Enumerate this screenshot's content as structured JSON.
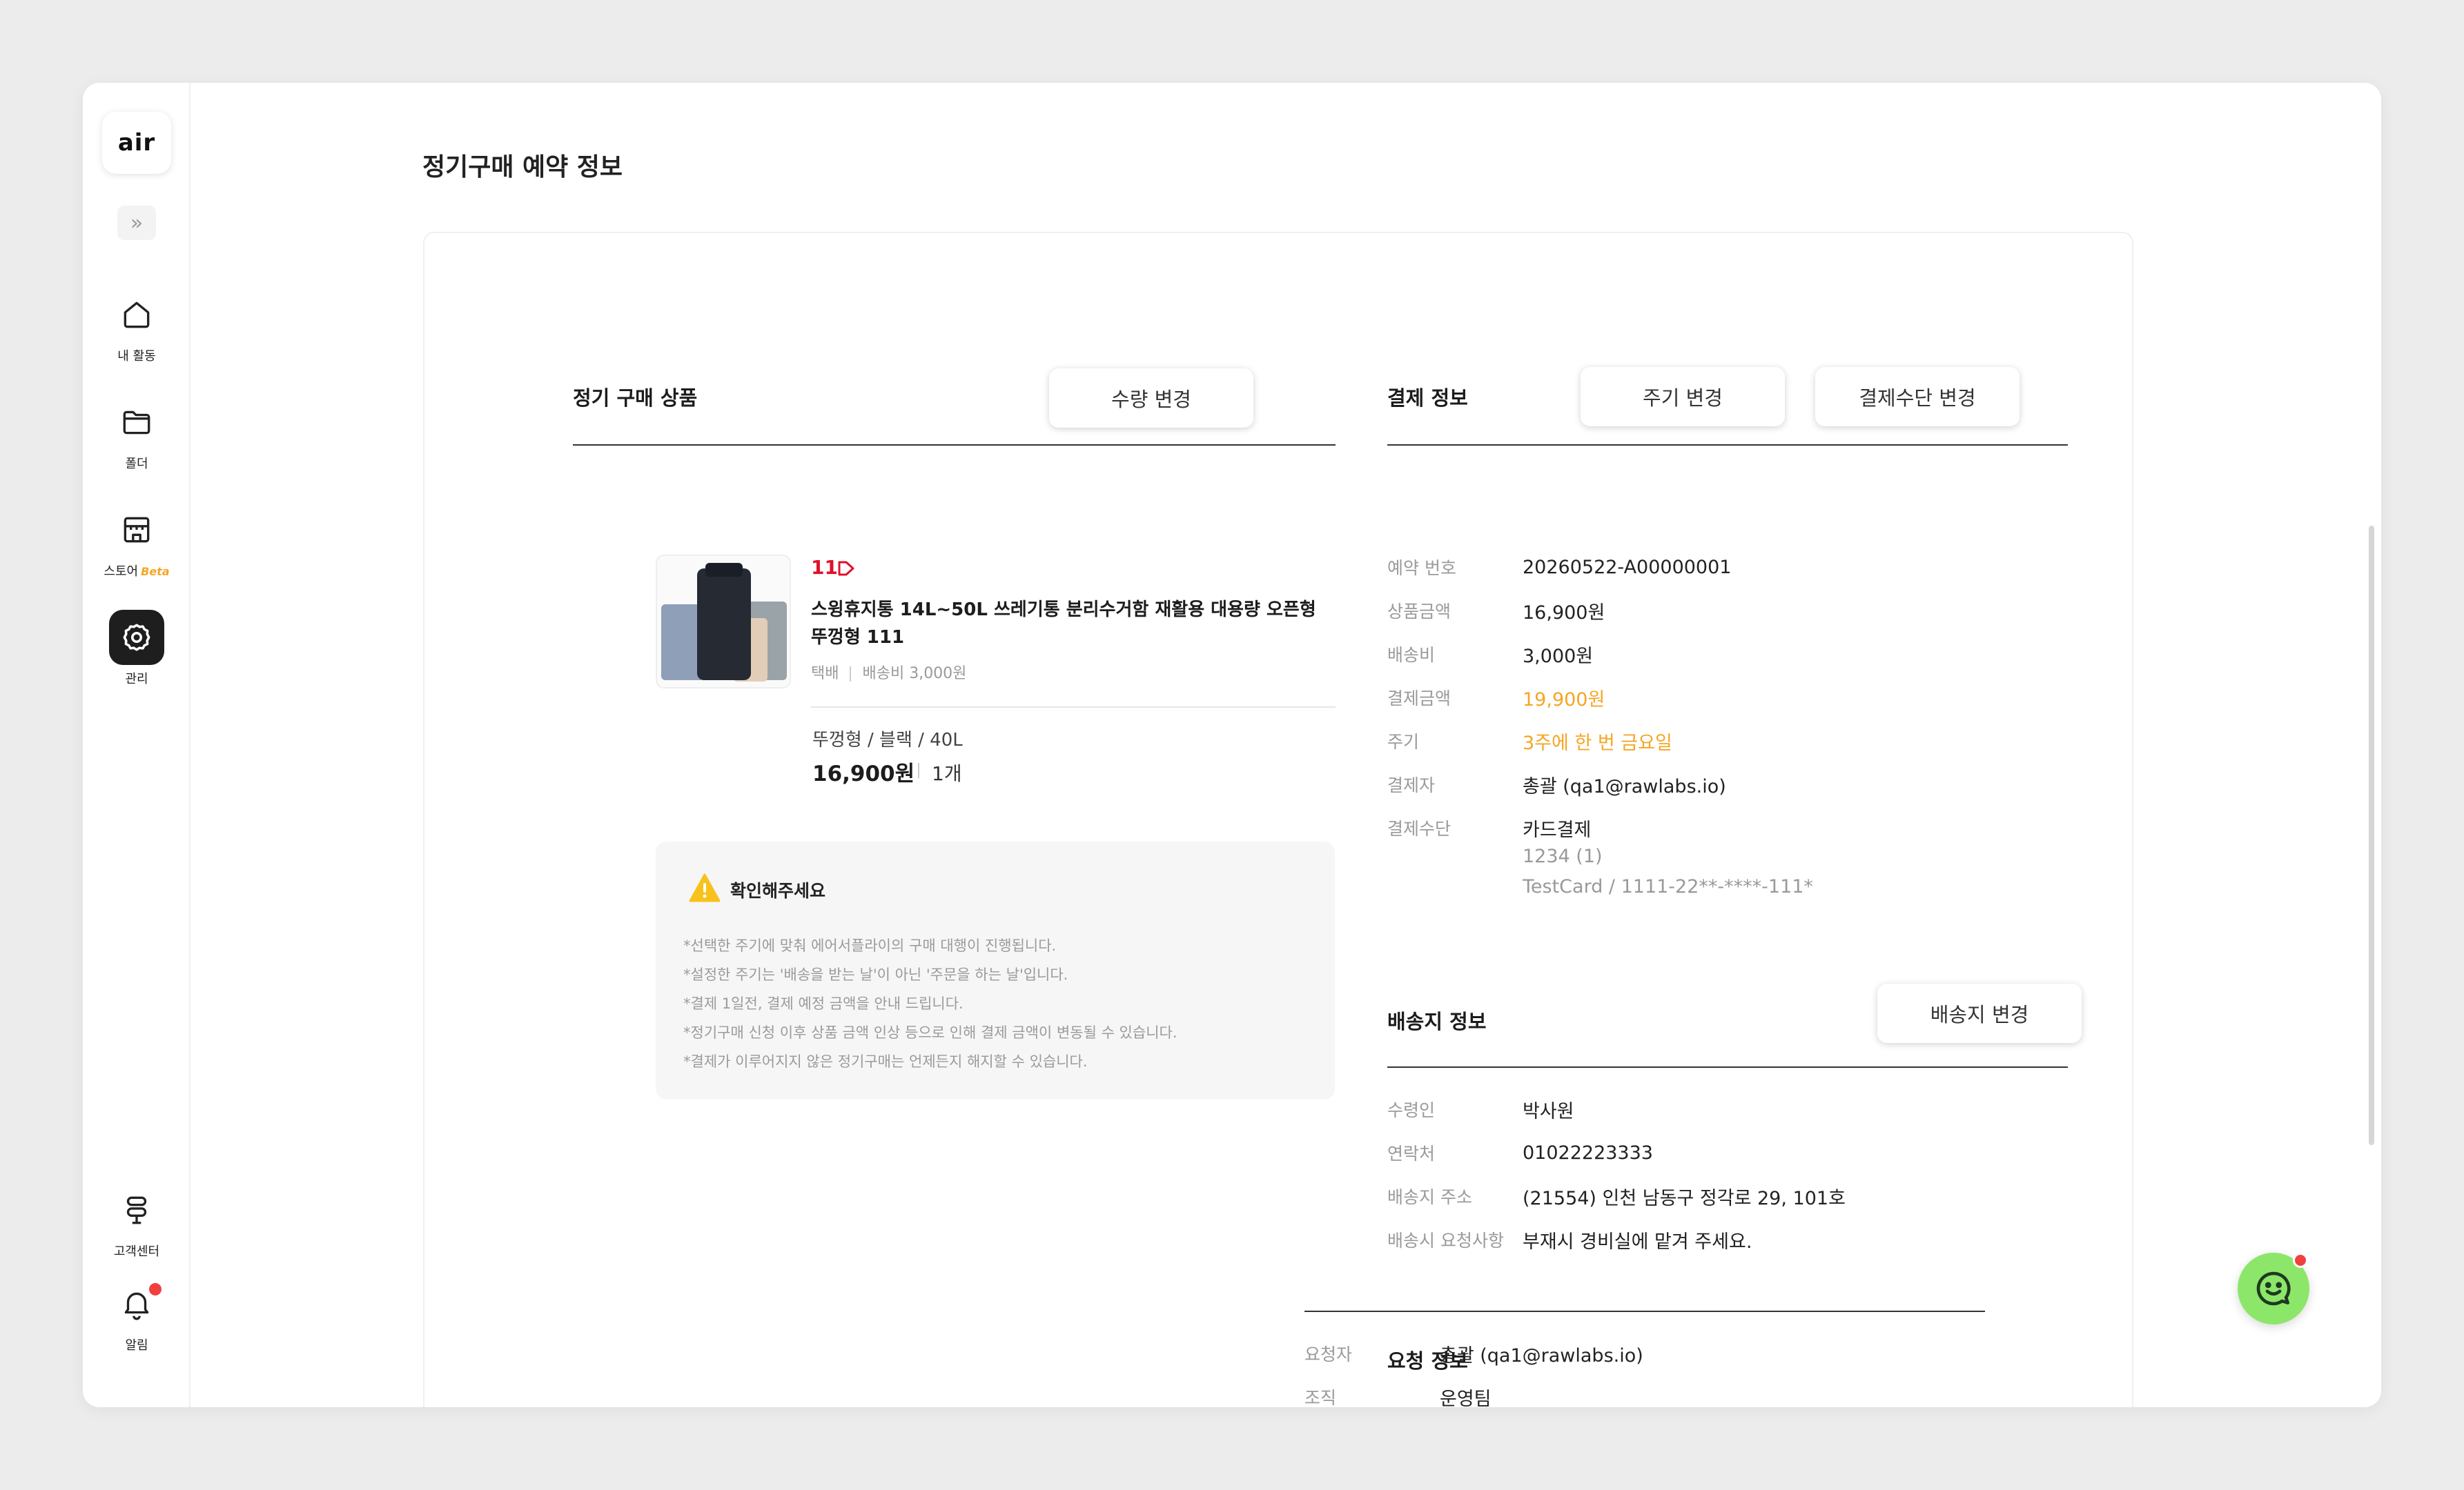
{
  "app": {
    "logo_text": "air",
    "expand_icon": "double-chevron-right-icon",
    "page_title": "정기구매 예약 정보"
  },
  "sidebar": {
    "items": [
      {
        "label": "내 활동",
        "icon": "home-icon"
      },
      {
        "label": "폴더",
        "icon": "folder-icon"
      },
      {
        "label": "스토어",
        "badge": "Beta",
        "icon": "store-icon"
      },
      {
        "label": "관리",
        "icon": "gear-icon",
        "active": true
      }
    ],
    "bottom": [
      {
        "label": "고객센터",
        "icon": "signpost-icon"
      },
      {
        "label": "알림",
        "icon": "bell-icon",
        "has_dot": true
      }
    ]
  },
  "product_section": {
    "title": "정기 구매 상품",
    "button": "수량 변경",
    "mall_logo": "11",
    "product_name": "스윙휴지통 14L~50L 쓰레기통 분리수거함 재활용 대용량 오픈형 뚜껑형 111",
    "delivery": "택배",
    "shipping_fee": "배송비 3,000원",
    "option": "뚜껑형 / 블랙 / 40L",
    "price": "16,900원",
    "quantity": "1개"
  },
  "notice": {
    "title": "확인해주세요",
    "lines": [
      "*선택한 주기에 맞춰 에어서플라이의 구매 대행이 진행됩니다.",
      "*설정한 주기는 '배송을 받는 날'이 아닌 '주문을 하는 날'입니다.",
      "*결제 1일전, 결제 예정 금액을 안내 드립니다.",
      "*정기구매 신청 이후 상품 금액 인상 등으로 인해 결제 금액이 변동될 수 있습니다.",
      "*결제가 이루어지지 않은 정기구매는 언제든지 해지할 수 있습니다."
    ]
  },
  "payment": {
    "title": "결제 정보",
    "btn_cycle": "주기 변경",
    "btn_method": "결제수단 변경",
    "rows": [
      {
        "label": "예약 번호",
        "value": "20260522-A00000001"
      },
      {
        "label": "상품금액",
        "value": "16,900원"
      },
      {
        "label": "배송비",
        "value": "3,000원"
      },
      {
        "label": "결제금액",
        "value": "19,900원"
      },
      {
        "label": "주기",
        "value": "3주에 한 번 금요일"
      },
      {
        "label": "결제자",
        "value": "총괄 (qa1@rawlabs.io)"
      },
      {
        "label": "결제수단",
        "value": "카드결제"
      }
    ],
    "method_sub1": "1234 (1)",
    "method_sub2": "TestCard / 1111-22**-****-111*",
    "highlight_color": "#f5a623"
  },
  "shipping": {
    "title": "배송지 정보",
    "button": "배송지 변경",
    "rows": [
      {
        "label": "수령인",
        "value": "박사원"
      },
      {
        "label": "연락처",
        "value": "01022223333"
      },
      {
        "label": "배송지 주소",
        "value": "(21554) 인천 남동구 정각로 29, 101호"
      },
      {
        "label": "배송시 요청사항",
        "value": "부재시 경비실에 맡겨 주세요."
      }
    ]
  },
  "request": {
    "title": "요청 정보",
    "rows": [
      {
        "label": "요청자",
        "value": "총괄 (qa1@rawlabs.io)"
      },
      {
        "label": "조직",
        "value": "운영팀"
      }
    ]
  },
  "chat_icon": "chat-bubble-icon"
}
